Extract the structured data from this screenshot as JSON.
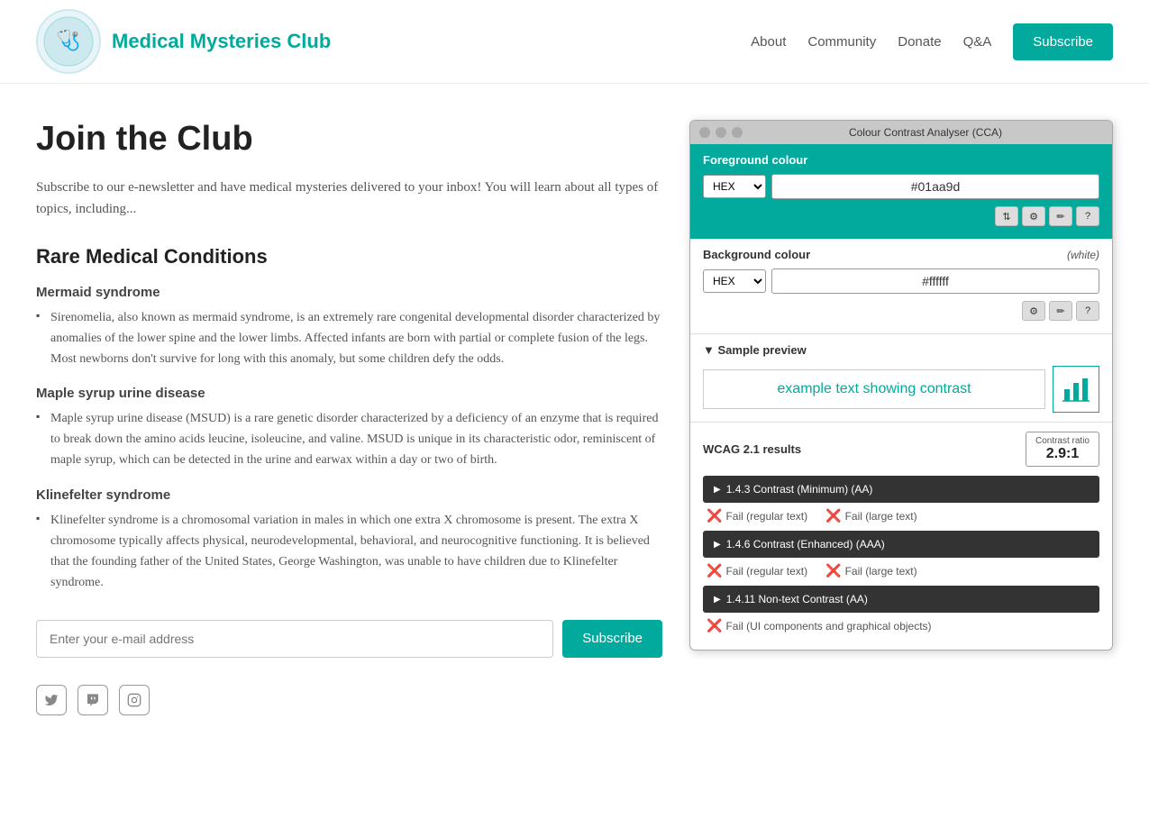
{
  "header": {
    "logo_alt": "Medical Mysteries Club logo",
    "title": "Medical Mysteries Club",
    "nav": {
      "about": "About",
      "community": "Community",
      "donate": "Donate",
      "qa": "Q&A",
      "subscribe": "Subscribe"
    }
  },
  "content": {
    "page_title": "Join the Club",
    "intro": "Subscribe to our e-newsletter and have medical mysteries delivered to your inbox! You will learn about all types of topics, including...",
    "section_title": "Rare Medical Conditions",
    "conditions": [
      {
        "title": "Mermaid syndrome",
        "items": [
          "Sirenomelia, also known as mermaid syndrome, is an extremely rare congenital developmental disorder characterized by anomalies of the lower spine and the lower limbs. Affected infants are born with partial or complete fusion of the legs. Most newborns don't survive for long with this anomaly, but some children defy the odds."
        ]
      },
      {
        "title": "Maple syrup urine disease",
        "items": [
          "Maple syrup urine disease (MSUD) is a rare genetic disorder characterized by a deficiency of an enzyme that is required to break down the amino acids leucine, isoleucine, and valine. MSUD is unique in its characteristic odor, reminiscent of maple syrup, which can be detected in the urine and earwax within a day or two of birth."
        ]
      },
      {
        "title": "Klinefelter syndrome",
        "items": [
          "Klinefelter syndrome is a chromosomal variation in males in which one extra X chromosome is present. The extra X chromosome typically affects physical, neurodevelopmental, behavioral, and neurocognitive functioning. It is believed that the founding father of the United States, George Washington, was unable to have children due to Klinefelter syndrome."
        ]
      }
    ],
    "email_placeholder": "Enter your e-mail address",
    "subscribe_btn": "Subscribe"
  },
  "social": {
    "twitter": "🐦",
    "twitch": "📺",
    "instagram": "📷"
  },
  "cca": {
    "titlebar": "Colour Contrast Analyser (CCA)",
    "foreground_label": "Foreground colour",
    "foreground_format": "HEX",
    "foreground_value": "#01aa9d",
    "background_label": "Background colour",
    "background_note": "(white)",
    "background_format": "HEX",
    "background_value": "#ffffff",
    "preview_header": "▼ Sample preview",
    "sample_text": "example text showing contrast",
    "results_title": "WCAG 2.1 results",
    "contrast_ratio_label": "Contrast ratio",
    "contrast_ratio_value": "2.9:1",
    "criteria": [
      {
        "label": "1.4.3 Contrast (Minimum) (AA)",
        "fail_regular": "Fail (regular text)",
        "fail_large": "Fail (large text)"
      },
      {
        "label": "1.4.6 Contrast (Enhanced) (AAA)",
        "fail_regular": "Fail (regular text)",
        "fail_large": "Fail (large text)"
      },
      {
        "label": "1.4.11 Non-text Contrast (AA)",
        "fail_regular": "Fail (UI components and graphical objects)",
        "fail_large": null
      }
    ],
    "icons": {
      "adjust": "⇅",
      "sliders": "⚙",
      "eyedropper": "✏",
      "help": "?"
    }
  }
}
